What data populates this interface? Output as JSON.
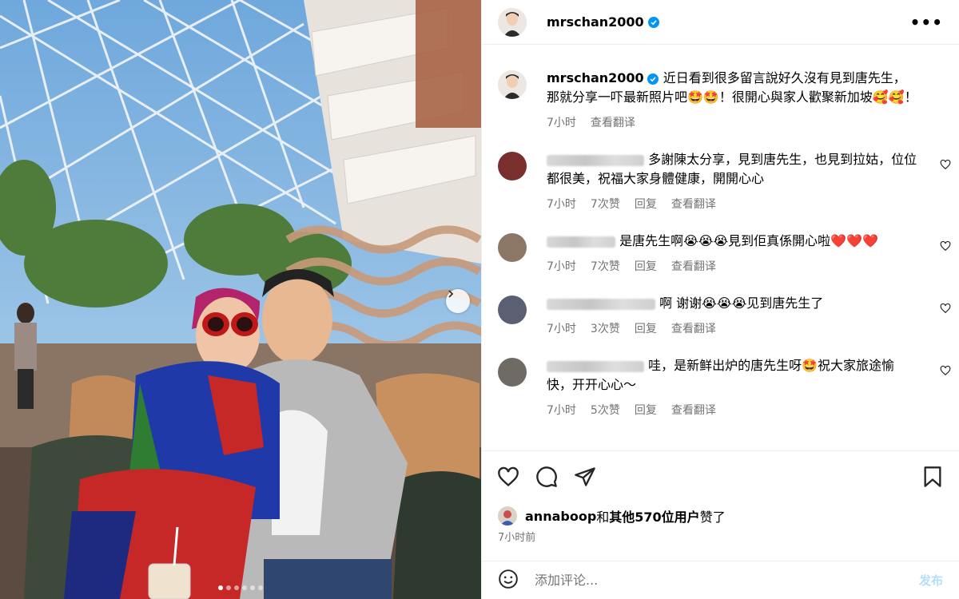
{
  "post": {
    "username": "mrschan2000",
    "caption": "近日看到很多留言說好久沒有見到唐先生，那就分享一吓最新照片吧🤩🤩！很開心與家人歡聚新加坡🥰🥰！",
    "time": "7小时",
    "see_translation": "查看翻译",
    "photo_count": 6,
    "active_photo": 1
  },
  "comments": [
    {
      "text": "多謝陳太分享，見到唐先生，也見到拉姑，位位都很美，祝福大家身體健康，開開心心",
      "time": "7小时",
      "likes": "7次赞",
      "reply": "回复",
      "translate": "查看翻译"
    },
    {
      "text": "是唐先生啊😭😭😭見到佢真係開心啦❤️❤️❤️",
      "time": "7小时",
      "likes": "7次赞",
      "reply": "回复",
      "translate": "查看翻译"
    },
    {
      "text": "啊 谢谢😭😭😭见到唐先生了",
      "time": "7小时",
      "likes": "3次赞",
      "reply": "回复",
      "translate": "查看翻译"
    },
    {
      "text": "哇，是新鲜出炉的唐先生呀🤩祝大家旅途愉快，开开心心～",
      "time": "7小时",
      "likes": "5次赞",
      "reply": "回复",
      "translate": "查看翻译"
    }
  ],
  "likes": {
    "user": "annaboop",
    "joiner": "和",
    "others": "其他570位用户",
    "suffix": "赞了"
  },
  "post_time": "7小时前",
  "add_comment": {
    "placeholder": "添加评论...",
    "post_label": "发布"
  },
  "colors": {
    "verified": "#0095f6",
    "post_button": "#b2dffc",
    "meta": "#737373"
  },
  "icons": [
    "more-icon",
    "verified-icon",
    "heart-icon",
    "comment-icon",
    "share-icon",
    "save-icon",
    "emoji-icon",
    "chevron-right-icon"
  ]
}
